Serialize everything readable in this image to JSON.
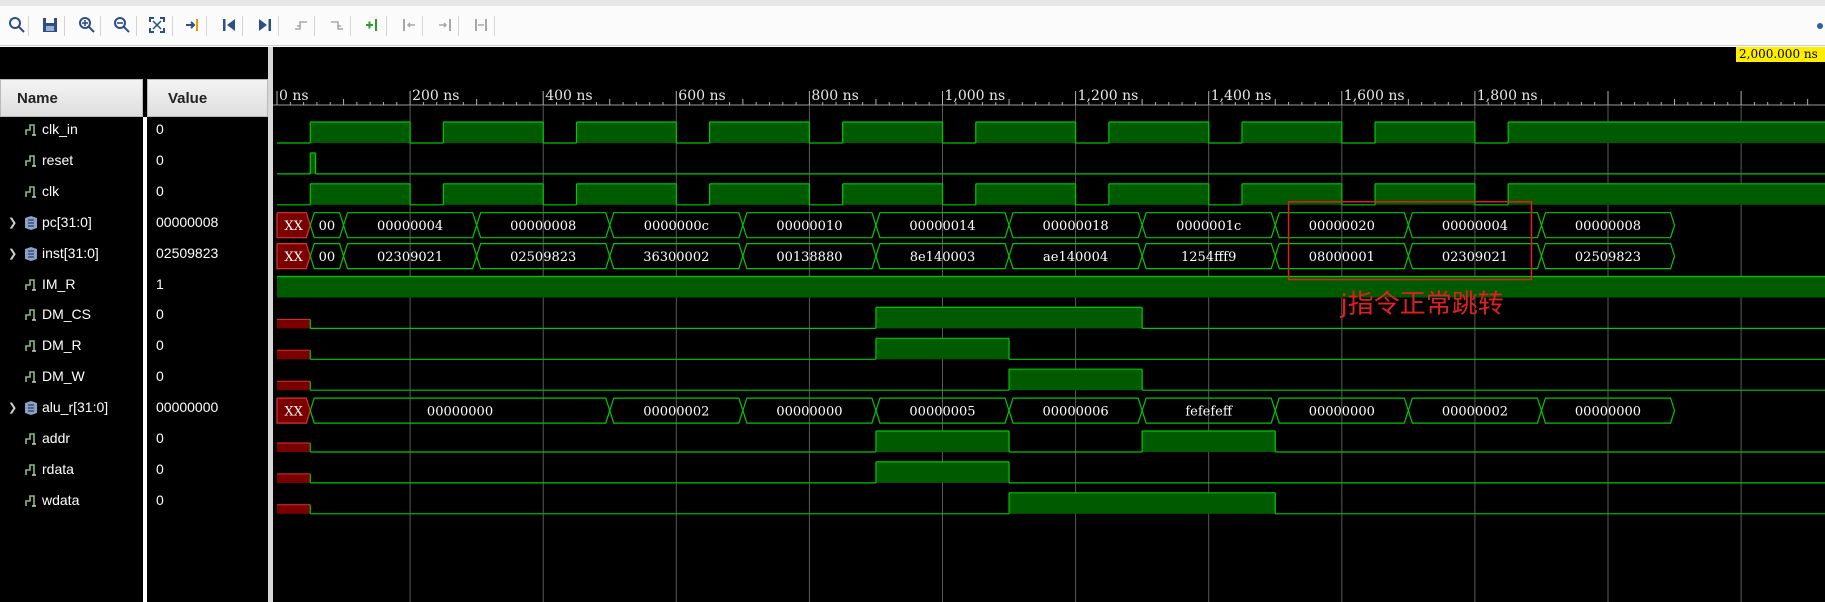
{
  "toolbar": {
    "icons": [
      "search-icon",
      "save-icon",
      "zoom-in-icon",
      "zoom-out-icon",
      "zoom-fit-icon",
      "go-to-cursor-icon",
      "go-to-start-icon",
      "go-to-end-icon",
      "prev-transition-icon",
      "next-transition-icon",
      "add-marker-icon",
      "prev-marker-icon",
      "next-marker-icon",
      "swap-cursors-icon"
    ]
  },
  "columns": {
    "name": "Name",
    "value": "Value"
  },
  "signals": [
    {
      "name": "clk_in",
      "value": "0",
      "kind": "bit"
    },
    {
      "name": "reset",
      "value": "0",
      "kind": "bit"
    },
    {
      "name": "clk",
      "value": "0",
      "kind": "bit"
    },
    {
      "name": "pc[31:0]",
      "value": "00000008",
      "kind": "bus"
    },
    {
      "name": "inst[31:0]",
      "value": "02509823",
      "kind": "bus"
    },
    {
      "name": "IM_R",
      "value": "1",
      "kind": "bit"
    },
    {
      "name": "DM_CS",
      "value": "0",
      "kind": "bit"
    },
    {
      "name": "DM_R",
      "value": "0",
      "kind": "bit"
    },
    {
      "name": "DM_W",
      "value": "0",
      "kind": "bit"
    },
    {
      "name": "alu_r[31:0]",
      "value": "00000000",
      "kind": "bus"
    },
    {
      "name": "addr",
      "value": "0",
      "kind": "bit"
    },
    {
      "name": "rdata",
      "value": "0",
      "kind": "bit"
    },
    {
      "name": "wdata",
      "value": "0",
      "kind": "bit"
    }
  ],
  "ruler": {
    "labels": [
      "0 ns",
      "200 ns",
      "400 ns",
      "600 ns",
      "800 ns",
      "1,000 ns",
      "1,200 ns",
      "1,400 ns",
      "1,600 ns",
      "1,800 ns"
    ],
    "marker": "2,000.000 ns"
  },
  "waves": {
    "clk_in": {
      "init": 0,
      "toggles": [
        50,
        200,
        250,
        400,
        450,
        600,
        650,
        800,
        850,
        1000,
        1050,
        1200,
        1250,
        1400,
        1450,
        1600,
        1650,
        1800,
        1850
      ]
    },
    "reset": {
      "init": 0,
      "toggles": [
        50,
        58
      ]
    },
    "clk": {
      "init": 0,
      "toggles": [
        50,
        200,
        250,
        400,
        450,
        600,
        650,
        800,
        850,
        1000,
        1050,
        1200,
        1250,
        1400,
        1450,
        1600,
        1650,
        1800,
        1850
      ]
    },
    "IM_R": {
      "init": 1,
      "toggles": []
    },
    "DM_CS": {
      "init": "x",
      "xEnd": 50,
      "toggles": [
        900,
        1300
      ]
    },
    "DM_R": {
      "init": "x",
      "xEnd": 50,
      "toggles": [
        900,
        1100
      ]
    },
    "DM_W": {
      "init": "x",
      "xEnd": 50,
      "toggles": [
        1100,
        1300
      ]
    },
    "addr": {
      "init": "x",
      "xEnd": 50,
      "toggles": [
        900,
        1100,
        1300,
        1500
      ]
    },
    "rdata": {
      "init": "x",
      "xEnd": 50,
      "toggles": [
        900,
        1100
      ]
    },
    "wdata": {
      "init": "x",
      "xEnd": 50,
      "toggles": [
        1100,
        1500
      ]
    },
    "pc[31:0]": [
      {
        "t0": 0,
        "t1": 50,
        "v": "XX",
        "x": true
      },
      {
        "t0": 50,
        "t1": 100,
        "v": "00"
      },
      {
        "t0": 100,
        "t1": 300,
        "v": "00000004"
      },
      {
        "t0": 300,
        "t1": 500,
        "v": "00000008"
      },
      {
        "t0": 500,
        "t1": 700,
        "v": "0000000c"
      },
      {
        "t0": 700,
        "t1": 900,
        "v": "00000010"
      },
      {
        "t0": 900,
        "t1": 1100,
        "v": "00000014"
      },
      {
        "t0": 1100,
        "t1": 1300,
        "v": "00000018"
      },
      {
        "t0": 1300,
        "t1": 1500,
        "v": "0000001c"
      },
      {
        "t0": 1500,
        "t1": 1700,
        "v": "00000020"
      },
      {
        "t0": 1700,
        "t1": 1900,
        "v": "00000004"
      },
      {
        "t0": 1900,
        "t1": 2100,
        "v": "00000008"
      }
    ],
    "inst[31:0]": [
      {
        "t0": 0,
        "t1": 50,
        "v": "XX",
        "x": true
      },
      {
        "t0": 50,
        "t1": 100,
        "v": "00"
      },
      {
        "t0": 100,
        "t1": 300,
        "v": "02309021"
      },
      {
        "t0": 300,
        "t1": 500,
        "v": "02509823"
      },
      {
        "t0": 500,
        "t1": 700,
        "v": "36300002"
      },
      {
        "t0": 700,
        "t1": 900,
        "v": "00138880"
      },
      {
        "t0": 900,
        "t1": 1100,
        "v": "8e140003"
      },
      {
        "t0": 1100,
        "t1": 1300,
        "v": "ae140004"
      },
      {
        "t0": 1300,
        "t1": 1500,
        "v": "1254fff9"
      },
      {
        "t0": 1500,
        "t1": 1700,
        "v": "08000001"
      },
      {
        "t0": 1700,
        "t1": 1900,
        "v": "02309021"
      },
      {
        "t0": 1900,
        "t1": 2100,
        "v": "02509823"
      }
    ],
    "alu_r[31:0]": [
      {
        "t0": 0,
        "t1": 50,
        "v": "XX",
        "x": true
      },
      {
        "t0": 50,
        "t1": 500,
        "v": "00000000"
      },
      {
        "t0": 500,
        "t1": 700,
        "v": "00000002"
      },
      {
        "t0": 700,
        "t1": 900,
        "v": "00000000"
      },
      {
        "t0": 900,
        "t1": 1100,
        "v": "00000005"
      },
      {
        "t0": 1100,
        "t1": 1300,
        "v": "00000006"
      },
      {
        "t0": 1300,
        "t1": 1500,
        "v": "fefefeff"
      },
      {
        "t0": 1500,
        "t1": 1700,
        "v": "00000000"
      },
      {
        "t0": 1700,
        "t1": 1900,
        "v": "00000002"
      },
      {
        "t0": 1900,
        "t1": 2100,
        "v": "00000000"
      }
    ]
  },
  "annotation": {
    "text": "j指令正常跳转",
    "color": "#e02020",
    "t0": 1520,
    "t1": 1885
  },
  "colors": {
    "wave": "#00c800",
    "fill": "#005a00",
    "xfill": "#7a0000",
    "xline": "#e03030",
    "grid": "#5a5a5a"
  }
}
